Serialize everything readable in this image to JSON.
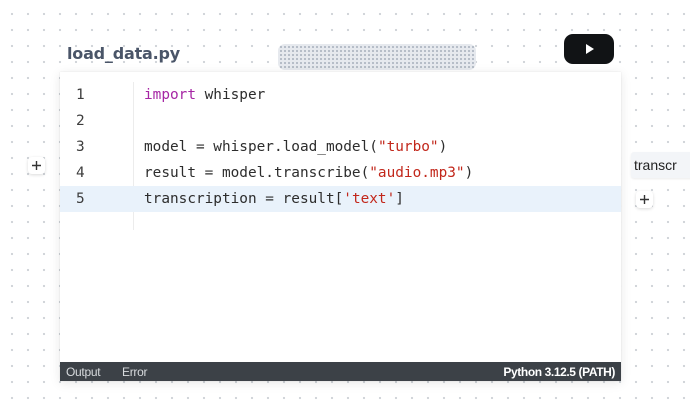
{
  "node": {
    "title": "load_data.py",
    "run_icon": "play-icon"
  },
  "editor": {
    "lines": [
      {
        "number": "1",
        "tokens": [
          {
            "text": "import",
            "type": "keyword"
          },
          {
            "text": " whisper",
            "type": "plain"
          }
        ]
      },
      {
        "number": "2",
        "tokens": []
      },
      {
        "number": "3",
        "tokens": [
          {
            "text": "model = whisper.load_model(",
            "type": "plain"
          },
          {
            "text": "\"turbo\"",
            "type": "string"
          },
          {
            "text": ")",
            "type": "plain"
          }
        ]
      },
      {
        "number": "4",
        "tokens": [
          {
            "text": "result = model.transcribe(",
            "type": "plain"
          },
          {
            "text": "\"audio.mp3\"",
            "type": "string"
          },
          {
            "text": ")",
            "type": "plain"
          }
        ]
      },
      {
        "number": "5",
        "tokens": [
          {
            "text": "transcription = result[",
            "type": "plain"
          },
          {
            "text": "'text'",
            "type": "string"
          },
          {
            "text": "]",
            "type": "plain"
          }
        ],
        "active": true
      }
    ]
  },
  "status_bar": {
    "tabs": [
      "Output",
      "Error"
    ],
    "interpreter": "Python 3.12.5 (PATH)"
  },
  "side_node": {
    "label": "transcr"
  },
  "handles": {
    "icon": "plus-icon"
  },
  "colors": {
    "keyword": "#a626a4",
    "string": "#c2271b",
    "active_line": "#e9f2fb",
    "status_bar": "#3c4147",
    "run_button": "#111315"
  }
}
